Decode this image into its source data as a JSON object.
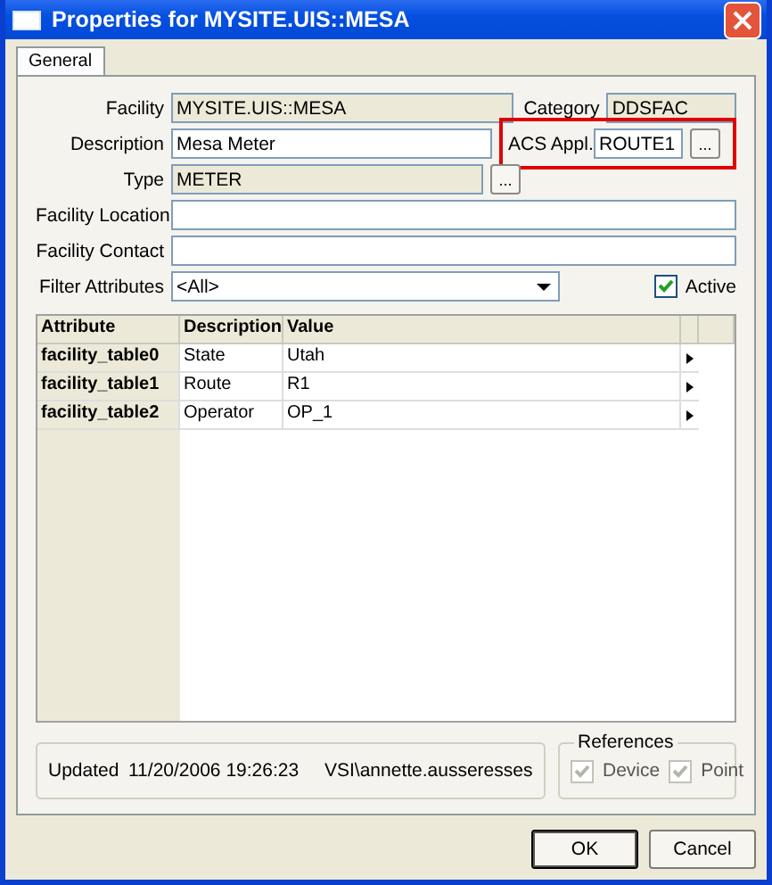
{
  "window": {
    "title": "Properties for MYSITE.UIS::MESA"
  },
  "tabs": [
    {
      "label": "General",
      "selected": true
    }
  ],
  "facility": {
    "label": "Facility",
    "value": "MYSITE.UIS::MESA",
    "disabled": true
  },
  "category": {
    "label": "Category",
    "value": "DDSFAC",
    "disabled": true
  },
  "description": {
    "label": "Description",
    "value": "Mesa Meter",
    "disabled": false
  },
  "acs_appl": {
    "label": "ACS Appl.",
    "value": "ROUTE1",
    "button": "...",
    "highlighted": true
  },
  "type": {
    "label": "Type",
    "value": "METER",
    "disabled": true,
    "button": "..."
  },
  "facility_location": {
    "label": "Facility Location",
    "disabled": false
  },
  "facility_contact": {
    "label": "Facility Contact",
    "disabled": false
  },
  "filter": {
    "label": "Filter Attributes",
    "value": "<All>"
  },
  "active": {
    "label": "Active",
    "checked": true
  },
  "grid": {
    "columns": [
      "Attribute",
      "Description",
      "Value"
    ],
    "rows": [
      {
        "attribute": "facility_table0",
        "description": "State",
        "value": "Utah"
      },
      {
        "attribute": "facility_table1",
        "description": "Route",
        "value": "R1"
      },
      {
        "attribute": "facility_table2",
        "description": "Operator",
        "value": "OP_1"
      }
    ]
  },
  "footer": {
    "label": "Updated",
    "date": "11/20/2006 19:26:23",
    "user": "VSI\\annette.ausseresses"
  },
  "references": {
    "title": "References",
    "items": [
      {
        "label": "Device",
        "checked": true,
        "disabled": true
      },
      {
        "label": "Point",
        "checked": true,
        "disabled": true
      }
    ]
  },
  "buttons": [
    {
      "label": "OK",
      "default": true
    },
    {
      "label": "Cancel",
      "default": false
    }
  ]
}
